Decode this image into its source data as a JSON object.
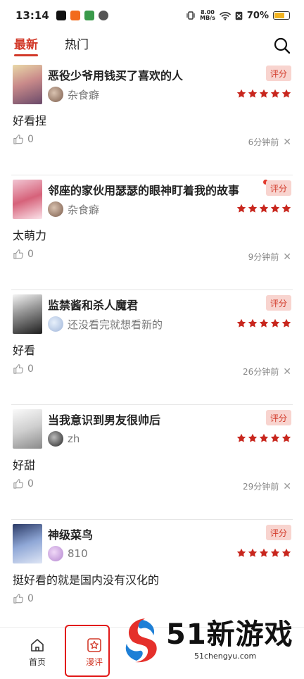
{
  "status_bar": {
    "time": "13:14",
    "net_speed": "8.00",
    "net_unit": "MB/s",
    "battery_label": "70%",
    "battery_level": 0.7
  },
  "tabs": [
    {
      "label": "最新",
      "active": true
    },
    {
      "label": "热门",
      "active": false
    }
  ],
  "reviews": [
    {
      "title": "恶役少爷用钱买了喜欢的人",
      "user": "杂食癖",
      "comment": "好看捏",
      "likes": "0",
      "time": "6分钟前",
      "rating": 5,
      "badge": "评分",
      "new_dot": false
    },
    {
      "title": "邻座的家伙用瑟瑟的眼神盯着我的故事",
      "user": "杂食癖",
      "comment": "太萌力",
      "likes": "0",
      "time": "9分钟前",
      "rating": 5,
      "badge": "评分",
      "new_dot": true
    },
    {
      "title": "监禁酱和杀人魔君",
      "user": "还没看完就想看新的",
      "comment": "好看",
      "likes": "0",
      "time": "26分钟前",
      "rating": 5,
      "badge": "评分",
      "new_dot": false
    },
    {
      "title": "当我意识到男友很帅后",
      "user": "zh",
      "comment": "好甜",
      "likes": "0",
      "time": "29分钟前",
      "rating": 5,
      "badge": "评分",
      "new_dot": false
    },
    {
      "title": "神级菜鸟",
      "user": "810",
      "comment": "挺好看的就是国内没有汉化的",
      "likes": "0",
      "time": "",
      "rating": 5,
      "badge": "评分",
      "new_dot": false
    }
  ],
  "bottom_nav": {
    "home_label": "首页",
    "review_label": "漫评"
  },
  "watermark": {
    "main": "51新游戏",
    "url": "51chengyu.com"
  },
  "colors": {
    "accent": "#d23a2a",
    "star": "#c8261d",
    "badge_bg": "#f8d4cf"
  }
}
